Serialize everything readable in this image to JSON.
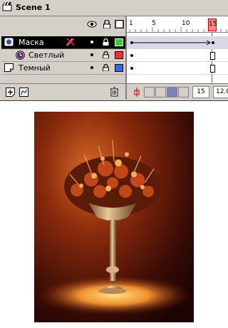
{
  "title_bar": {
    "scene_label": "Scene 1",
    "icon": "clapper-icon"
  },
  "timeline": {
    "header_icons": [
      "eye-icon",
      "lock-icon",
      "outline-icon"
    ],
    "frame_numbers": [
      "1",
      "5",
      "10",
      "15"
    ],
    "playhead_frame": "15",
    "layers": [
      {
        "name": "Маска",
        "type": "mask-layer-icon",
        "selected": true,
        "color": "#33cc33"
      },
      {
        "name": "Светлый",
        "type": "masked-layer-icon",
        "selected": false,
        "color": "#ee3333"
      },
      {
        "name": "Темный",
        "type": "normal-layer-icon",
        "selected": false,
        "color": "#3366ee"
      }
    ],
    "current_frame_field": "15",
    "fps_field": "12.0"
  },
  "stage": {
    "image": "still-life-photo-flower-bouquet-in-pedestal-vase",
    "colors": {
      "dark": "#2a0804",
      "mid": "#8a2a08",
      "light": "#f4a040"
    }
  }
}
